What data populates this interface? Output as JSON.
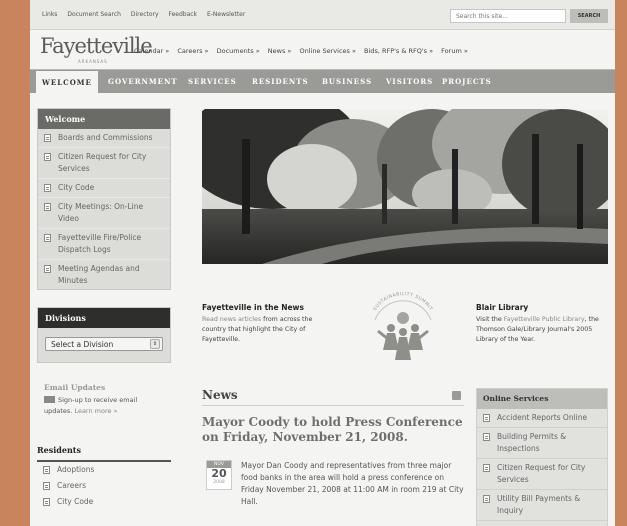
{
  "utility": {
    "links": [
      "Links",
      "Document Search",
      "Directory",
      "Feedback",
      "E-Newsletter"
    ],
    "search_placeholder": "Search this site...",
    "search_button": "SEARCH"
  },
  "logo": {
    "text": "Fayetteville",
    "sub": "ARKANSAS"
  },
  "mainnav": [
    "Calendar »",
    "Careers »",
    "Documents »",
    "News »",
    "Online Services »",
    "Bids, RFP's & RFQ's »",
    "Forum »"
  ],
  "tabs": [
    "WELCOME",
    "GOVERNMENT",
    "SERVICES",
    "RESIDENTS",
    "BUSINESS",
    "VISITORS",
    "PROJECTS"
  ],
  "welcome": {
    "title": "Welcome",
    "items": [
      "Boards and Commissions",
      "Citizen Request for City Services",
      "City Code",
      "City Meetings: On-Line Video",
      "Fayetteville Fire/Police Dispatch Logs",
      "Meeting Agendas and Minutes"
    ]
  },
  "divisions": {
    "title": "Divisions",
    "select_value": "Select a Division"
  },
  "email": {
    "title": "Email Updates",
    "text": "Sign-up to receive email updates.",
    "learn": "Learn more »"
  },
  "residents": {
    "title": "Residents",
    "items": [
      "Adoptions",
      "Careers",
      "City Code"
    ]
  },
  "news_feature": {
    "title": "Fayetteville in the News",
    "read": "Read news articles",
    "rest": " from across the country that highlight the City of Fayetteville."
  },
  "sustainability": {
    "label": "SUSTAINABILITY SUMMIT"
  },
  "library": {
    "title": "Blair Library",
    "pre": "Visit the ",
    "link": "Fayetteville Public Library",
    "post": ", the Thomson Gale/Library Journal's 2005 Library of the Year."
  },
  "news": {
    "title": "News",
    "headline": "Mayor Coody to hold Press Conference on Friday, November 21, 2008.",
    "date": {
      "month": "NOV",
      "day": "20",
      "year": "2008"
    },
    "body": "Mayor Dan Coody and representatives from three major food banks in the area will hold a press conference on Friday November 21, 2008 at 11:00 AM in room 219 at City Hall."
  },
  "online_services": {
    "title": "Online Services",
    "items": [
      "Accident Reports Online",
      "Building Permits & Inspections",
      "Citizen Request for City Services",
      "Utility Bill Payments & Inquiry"
    ]
  },
  "colors": {
    "background": "#c8845c",
    "tab_bar": "#9a9a96",
    "sidebar_head": "#6a6a67"
  }
}
